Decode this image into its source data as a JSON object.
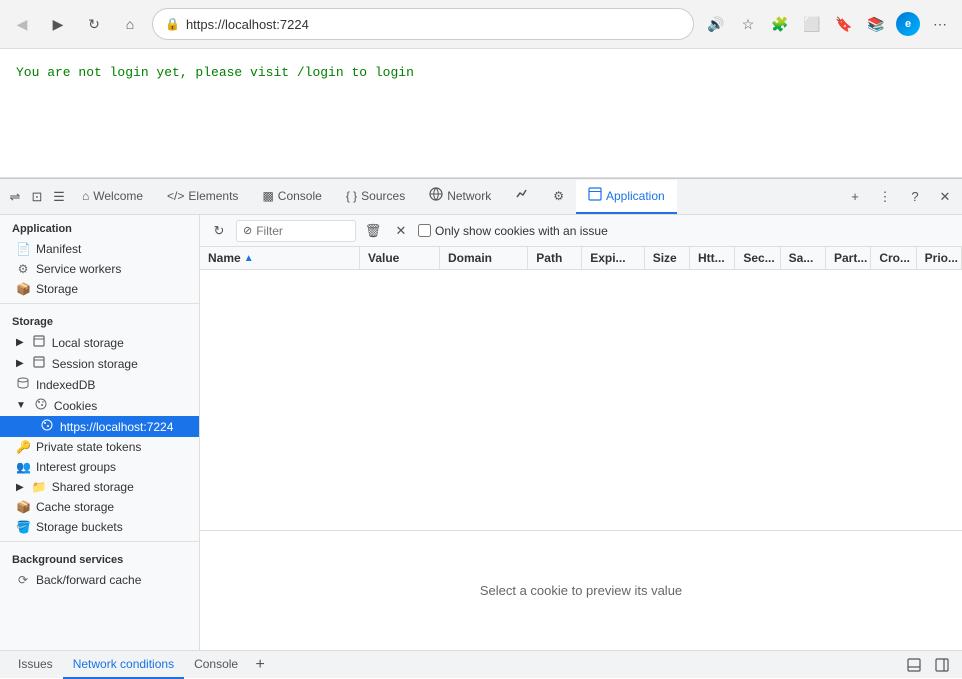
{
  "browser": {
    "url": "https://localhost:7224",
    "back_btn": "◀",
    "forward_btn": "▶",
    "refresh_btn": "↻",
    "home_btn": "⌂"
  },
  "page": {
    "message": "You are not login yet, please visit /login to login"
  },
  "devtools": {
    "tabs": [
      {
        "id": "side-btn-1",
        "icon": "⇔",
        "label": ""
      },
      {
        "id": "side-btn-2",
        "icon": "⬛",
        "label": ""
      },
      {
        "id": "side-btn-3",
        "icon": "☰",
        "label": ""
      },
      {
        "id": "welcome",
        "label": "Welcome",
        "icon": "⌂"
      },
      {
        "id": "elements",
        "label": "Elements",
        "icon": "</>"
      },
      {
        "id": "console",
        "label": "Console",
        "icon": "▤"
      },
      {
        "id": "sources",
        "label": "Sources",
        "icon": "{ }"
      },
      {
        "id": "network",
        "label": "Network",
        "icon": "📡"
      },
      {
        "id": "performance",
        "label": "",
        "icon": "⚡"
      },
      {
        "id": "settings",
        "label": "",
        "icon": "⚙"
      },
      {
        "id": "application",
        "label": "Application",
        "icon": "☰",
        "active": true
      }
    ],
    "action_buttons": {
      "more": "⋮",
      "help": "?",
      "close": "✕",
      "add": "+"
    }
  },
  "sidebar": {
    "section_application": "Application",
    "items_application": [
      {
        "id": "manifest",
        "icon": "📄",
        "label": "Manifest",
        "level": 0
      },
      {
        "id": "service-workers",
        "icon": "⚙",
        "label": "Service workers",
        "level": 0
      },
      {
        "id": "storage",
        "icon": "📦",
        "label": "Storage",
        "level": 0
      }
    ],
    "section_storage": "Storage",
    "items_storage": [
      {
        "id": "local-storage",
        "icon": "▤",
        "label": "Local storage",
        "level": 0,
        "expandable": true
      },
      {
        "id": "session-storage",
        "icon": "▤",
        "label": "Session storage",
        "level": 0,
        "expandable": true
      },
      {
        "id": "indexeddb",
        "icon": "🗃",
        "label": "IndexedDB",
        "level": 0
      },
      {
        "id": "cookies",
        "icon": "🍪",
        "label": "Cookies",
        "level": 0,
        "expandable": true,
        "expanded": true
      },
      {
        "id": "cookies-localhost",
        "icon": "🍪",
        "label": "https://localhost:7224",
        "level": 1,
        "active": true
      },
      {
        "id": "private-state-tokens",
        "icon": "🔑",
        "label": "Private state tokens",
        "level": 0
      },
      {
        "id": "interest-groups",
        "icon": "👥",
        "label": "Interest groups",
        "level": 0
      },
      {
        "id": "shared-storage",
        "icon": "📁",
        "label": "Shared storage",
        "level": 0,
        "expandable": true
      },
      {
        "id": "cache-storage",
        "icon": "📦",
        "label": "Cache storage",
        "level": 0
      },
      {
        "id": "storage-buckets",
        "icon": "🪣",
        "label": "Storage buckets",
        "level": 0
      }
    ],
    "section_background": "Background services",
    "items_background": [
      {
        "id": "back-forward-cache",
        "icon": "⟳",
        "label": "Back/forward cache",
        "level": 0
      }
    ]
  },
  "toolbar": {
    "refresh_icon": "↻",
    "filter_placeholder": "Filter",
    "filter_icon": "⊘",
    "clear_icon": "🗑",
    "delete_icon": "✕",
    "checkbox_label": "Only show cookies with an issue"
  },
  "table": {
    "columns": [
      {
        "id": "name",
        "label": "Name",
        "sort": true
      },
      {
        "id": "value",
        "label": "Value"
      },
      {
        "id": "domain",
        "label": "Domain"
      },
      {
        "id": "path",
        "label": "Path"
      },
      {
        "id": "expires",
        "label": "Expi..."
      },
      {
        "id": "size",
        "label": "Size"
      },
      {
        "id": "http",
        "label": "Htt..."
      },
      {
        "id": "secure",
        "label": "Sec..."
      },
      {
        "id": "samesite",
        "label": "Sa..."
      },
      {
        "id": "partition",
        "label": "Part..."
      },
      {
        "id": "cross",
        "label": "Cro..."
      },
      {
        "id": "priority",
        "label": "Prio..."
      }
    ],
    "rows": [],
    "preview_text": "Select a cookie to preview its value"
  },
  "bottom_bar": {
    "tabs": [
      {
        "id": "issues",
        "label": "Issues"
      },
      {
        "id": "network-conditions",
        "label": "Network conditions",
        "active": true
      },
      {
        "id": "console",
        "label": "Console"
      }
    ],
    "add_btn": "+",
    "dock_btn": "⬛",
    "undock_btn": "⬜"
  }
}
